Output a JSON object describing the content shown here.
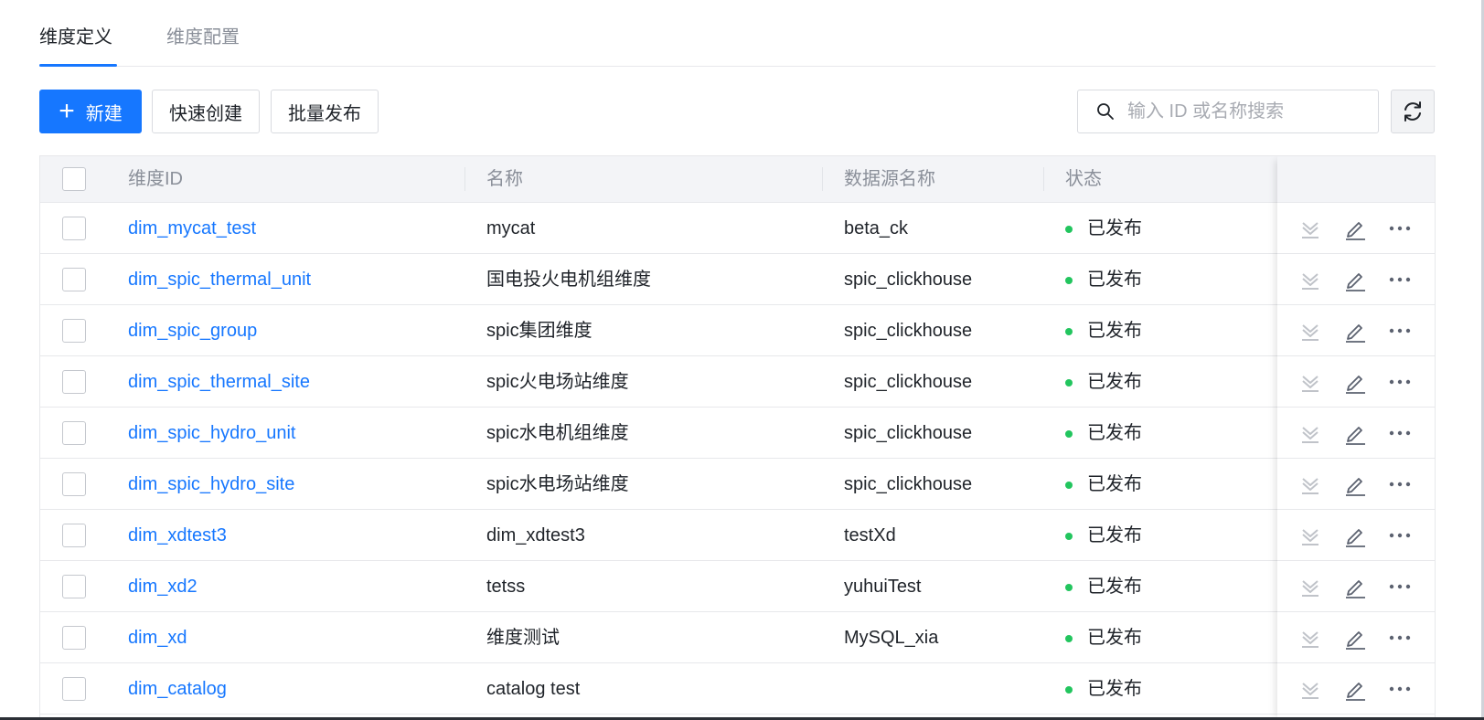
{
  "tabs": [
    {
      "label": "维度定义",
      "active": true
    },
    {
      "label": "维度配置",
      "active": false
    }
  ],
  "toolbar": {
    "new_label": "新建",
    "quick_create_label": "快速创建",
    "batch_publish_label": "批量发布",
    "search_placeholder": "输入 ID 或名称搜索",
    "search_value": ""
  },
  "table": {
    "columns": [
      "维度ID",
      "名称",
      "数据源名称",
      "状态"
    ],
    "rows": [
      {
        "id": "dim_mycat_test",
        "name": "mycat",
        "datasource": "beta_ck",
        "status": "已发布"
      },
      {
        "id": "dim_spic_thermal_unit",
        "name": "国电投火电机组维度",
        "datasource": "spic_clickhouse",
        "status": "已发布"
      },
      {
        "id": "dim_spic_group",
        "name": "spic集团维度",
        "datasource": "spic_clickhouse",
        "status": "已发布"
      },
      {
        "id": "dim_spic_thermal_site",
        "name": "spic火电场站维度",
        "datasource": "spic_clickhouse",
        "status": "已发布"
      },
      {
        "id": "dim_spic_hydro_unit",
        "name": "spic水电机组维度",
        "datasource": "spic_clickhouse",
        "status": "已发布"
      },
      {
        "id": "dim_spic_hydro_site",
        "name": "spic水电场站维度",
        "datasource": "spic_clickhouse",
        "status": "已发布"
      },
      {
        "id": "dim_xdtest3",
        "name": "dim_xdtest3",
        "datasource": "testXd",
        "status": "已发布"
      },
      {
        "id": "dim_xd2",
        "name": "tetss",
        "datasource": "yuhuiTest",
        "status": "已发布"
      },
      {
        "id": "dim_xd",
        "name": "维度测试",
        "datasource": "MySQL_xia",
        "status": "已发布"
      },
      {
        "id": "dim_catalog",
        "name": "catalog test",
        "datasource": "",
        "status": "已发布"
      }
    ],
    "row_actions": [
      "offline-icon",
      "edit-icon",
      "more-icon"
    ]
  },
  "colors": {
    "accent": "#1677ff",
    "status_published": "#22c55e",
    "header_bg": "#f3f4f7",
    "muted_text": "#8a8f99"
  }
}
